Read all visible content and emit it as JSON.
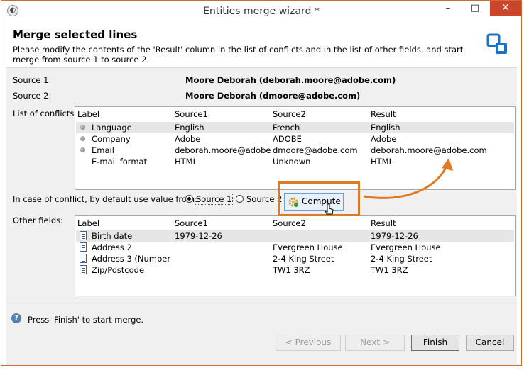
{
  "window": {
    "title": "Entities merge wizard *",
    "app_icon": "wizard-icon",
    "minimize": "–",
    "maximize": "□",
    "close": "✕"
  },
  "header": {
    "title": "Merge selected lines",
    "description": "Please modify the contents of the 'Result' column in the list of conflicts and in the list of other fields, and start merge from source 1 to source 2.",
    "icon": "merge-icon"
  },
  "sources": {
    "source1_label": "Source 1:",
    "source1_value": "Moore Deborah (deborah.moore@adobe.com)",
    "source2_label": "Source 2:",
    "source2_value": "Moore Deborah (dmoore@adobe.com)"
  },
  "conflicts": {
    "label": "List of conflicts:",
    "columns": [
      "Label",
      "Source1",
      "Source2",
      "Result"
    ],
    "rows": [
      {
        "label": "Language",
        "source1": "English",
        "source2": "French",
        "result": "English"
      },
      {
        "label": "Company",
        "source1": "Adobe",
        "source2": "ADOBE",
        "result": "Adobe"
      },
      {
        "label": "Email",
        "source1": "deborah.moore@adobe...",
        "source2": "dmoore@adobe.com",
        "result": "deborah.moore@adobe.com"
      },
      {
        "label": "E-mail format",
        "source1": "HTML",
        "source2": "Unknown",
        "result": "HTML"
      }
    ]
  },
  "default_value": {
    "label": "In case of conflict, by default use value from:",
    "option1": "Source 1",
    "option2": "Source 2",
    "selected": "Source 1",
    "compute_label": "Compute"
  },
  "other_fields": {
    "label": "Other fields:",
    "columns": [
      "Label",
      "Source1",
      "Source2",
      "Result"
    ],
    "rows": [
      {
        "label": "Birth date",
        "source1": "1979-12-26",
        "source2": "",
        "result": "1979-12-26"
      },
      {
        "label": "Address 2",
        "source1": "",
        "source2": "Evergreen House",
        "result": "Evergreen House"
      },
      {
        "label": "Address 3 (Number ...",
        "source1": "",
        "source2": "2-4 King Street",
        "result": "2-4 King Street"
      },
      {
        "label": "Zip/Postcode",
        "source1": "",
        "source2": "TW1 3RZ",
        "result": "TW1 3RZ"
      }
    ]
  },
  "footer": {
    "help_text": "Press 'Finish' to start merge.",
    "previous": "< Previous",
    "next": "Next >",
    "finish": "Finish",
    "cancel": "Cancel"
  },
  "colors": {
    "annotation": "#e07a22",
    "close_button": "#c9462c"
  }
}
